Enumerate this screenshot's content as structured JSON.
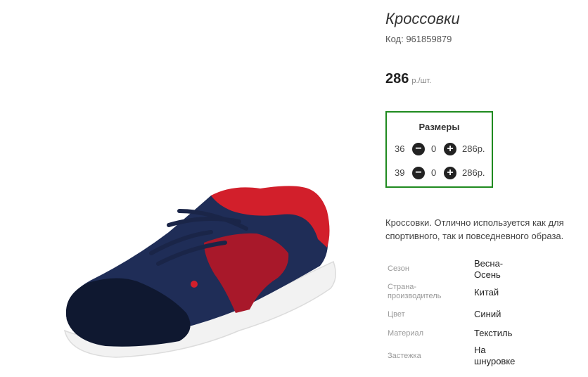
{
  "product": {
    "title": "Кроссовки",
    "code": "Код: 961859879",
    "price_value": "286",
    "price_unit": "р./шт.",
    "image_alt": "sneaker-photo"
  },
  "sizes": {
    "title": "Размеры",
    "rows": [
      {
        "size": "36",
        "qty": "0",
        "price": "286р.",
        "minus": "−",
        "plus": "+"
      },
      {
        "size": "39",
        "qty": "0",
        "price": "286р.",
        "minus": "−",
        "plus": "+"
      }
    ],
    "border_color": "#1f8a1f"
  },
  "description": {
    "line1": "Кроссовки. Отлично используется как для",
    "line2": "спортивного, так и повседневного образа."
  },
  "specs": [
    {
      "label": "Сезон",
      "value_line1": "Весна-",
      "value_line2": "Осень"
    },
    {
      "label_line1": "Страна-",
      "label_line2": "производитель",
      "value": "Китай"
    },
    {
      "label": "Цвет",
      "value": "Синий"
    },
    {
      "label": "Материал",
      "value": "Текстиль"
    },
    {
      "label": "Застежка",
      "value_line1": "На",
      "value_line2": "шнуровке"
    }
  ]
}
